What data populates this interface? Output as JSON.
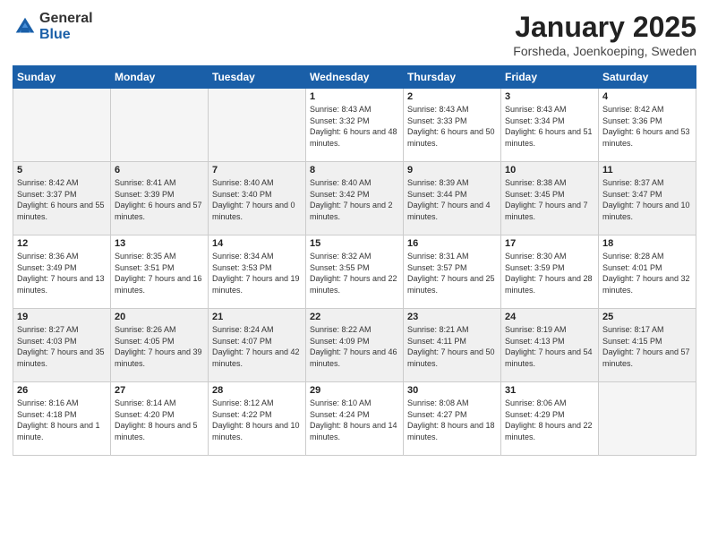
{
  "header": {
    "logo_general": "General",
    "logo_blue": "Blue",
    "month_title": "January 2025",
    "location": "Forsheda, Joenkoeping, Sweden"
  },
  "days_of_week": [
    "Sunday",
    "Monday",
    "Tuesday",
    "Wednesday",
    "Thursday",
    "Friday",
    "Saturday"
  ],
  "weeks": [
    [
      {
        "day": "",
        "sunrise": "",
        "sunset": "",
        "daylight": "",
        "empty": true
      },
      {
        "day": "",
        "sunrise": "",
        "sunset": "",
        "daylight": "",
        "empty": true
      },
      {
        "day": "",
        "sunrise": "",
        "sunset": "",
        "daylight": "",
        "empty": true
      },
      {
        "day": "1",
        "sunrise": "Sunrise: 8:43 AM",
        "sunset": "Sunset: 3:32 PM",
        "daylight": "Daylight: 6 hours and 48 minutes.",
        "empty": false
      },
      {
        "day": "2",
        "sunrise": "Sunrise: 8:43 AM",
        "sunset": "Sunset: 3:33 PM",
        "daylight": "Daylight: 6 hours and 50 minutes.",
        "empty": false
      },
      {
        "day": "3",
        "sunrise": "Sunrise: 8:43 AM",
        "sunset": "Sunset: 3:34 PM",
        "daylight": "Daylight: 6 hours and 51 minutes.",
        "empty": false
      },
      {
        "day": "4",
        "sunrise": "Sunrise: 8:42 AM",
        "sunset": "Sunset: 3:36 PM",
        "daylight": "Daylight: 6 hours and 53 minutes.",
        "empty": false
      }
    ],
    [
      {
        "day": "5",
        "sunrise": "Sunrise: 8:42 AM",
        "sunset": "Sunset: 3:37 PM",
        "daylight": "Daylight: 6 hours and 55 minutes.",
        "empty": false
      },
      {
        "day": "6",
        "sunrise": "Sunrise: 8:41 AM",
        "sunset": "Sunset: 3:39 PM",
        "daylight": "Daylight: 6 hours and 57 minutes.",
        "empty": false
      },
      {
        "day": "7",
        "sunrise": "Sunrise: 8:40 AM",
        "sunset": "Sunset: 3:40 PM",
        "daylight": "Daylight: 7 hours and 0 minutes.",
        "empty": false
      },
      {
        "day": "8",
        "sunrise": "Sunrise: 8:40 AM",
        "sunset": "Sunset: 3:42 PM",
        "daylight": "Daylight: 7 hours and 2 minutes.",
        "empty": false
      },
      {
        "day": "9",
        "sunrise": "Sunrise: 8:39 AM",
        "sunset": "Sunset: 3:44 PM",
        "daylight": "Daylight: 7 hours and 4 minutes.",
        "empty": false
      },
      {
        "day": "10",
        "sunrise": "Sunrise: 8:38 AM",
        "sunset": "Sunset: 3:45 PM",
        "daylight": "Daylight: 7 hours and 7 minutes.",
        "empty": false
      },
      {
        "day": "11",
        "sunrise": "Sunrise: 8:37 AM",
        "sunset": "Sunset: 3:47 PM",
        "daylight": "Daylight: 7 hours and 10 minutes.",
        "empty": false
      }
    ],
    [
      {
        "day": "12",
        "sunrise": "Sunrise: 8:36 AM",
        "sunset": "Sunset: 3:49 PM",
        "daylight": "Daylight: 7 hours and 13 minutes.",
        "empty": false
      },
      {
        "day": "13",
        "sunrise": "Sunrise: 8:35 AM",
        "sunset": "Sunset: 3:51 PM",
        "daylight": "Daylight: 7 hours and 16 minutes.",
        "empty": false
      },
      {
        "day": "14",
        "sunrise": "Sunrise: 8:34 AM",
        "sunset": "Sunset: 3:53 PM",
        "daylight": "Daylight: 7 hours and 19 minutes.",
        "empty": false
      },
      {
        "day": "15",
        "sunrise": "Sunrise: 8:32 AM",
        "sunset": "Sunset: 3:55 PM",
        "daylight": "Daylight: 7 hours and 22 minutes.",
        "empty": false
      },
      {
        "day": "16",
        "sunrise": "Sunrise: 8:31 AM",
        "sunset": "Sunset: 3:57 PM",
        "daylight": "Daylight: 7 hours and 25 minutes.",
        "empty": false
      },
      {
        "day": "17",
        "sunrise": "Sunrise: 8:30 AM",
        "sunset": "Sunset: 3:59 PM",
        "daylight": "Daylight: 7 hours and 28 minutes.",
        "empty": false
      },
      {
        "day": "18",
        "sunrise": "Sunrise: 8:28 AM",
        "sunset": "Sunset: 4:01 PM",
        "daylight": "Daylight: 7 hours and 32 minutes.",
        "empty": false
      }
    ],
    [
      {
        "day": "19",
        "sunrise": "Sunrise: 8:27 AM",
        "sunset": "Sunset: 4:03 PM",
        "daylight": "Daylight: 7 hours and 35 minutes.",
        "empty": false
      },
      {
        "day": "20",
        "sunrise": "Sunrise: 8:26 AM",
        "sunset": "Sunset: 4:05 PM",
        "daylight": "Daylight: 7 hours and 39 minutes.",
        "empty": false
      },
      {
        "day": "21",
        "sunrise": "Sunrise: 8:24 AM",
        "sunset": "Sunset: 4:07 PM",
        "daylight": "Daylight: 7 hours and 42 minutes.",
        "empty": false
      },
      {
        "day": "22",
        "sunrise": "Sunrise: 8:22 AM",
        "sunset": "Sunset: 4:09 PM",
        "daylight": "Daylight: 7 hours and 46 minutes.",
        "empty": false
      },
      {
        "day": "23",
        "sunrise": "Sunrise: 8:21 AM",
        "sunset": "Sunset: 4:11 PM",
        "daylight": "Daylight: 7 hours and 50 minutes.",
        "empty": false
      },
      {
        "day": "24",
        "sunrise": "Sunrise: 8:19 AM",
        "sunset": "Sunset: 4:13 PM",
        "daylight": "Daylight: 7 hours and 54 minutes.",
        "empty": false
      },
      {
        "day": "25",
        "sunrise": "Sunrise: 8:17 AM",
        "sunset": "Sunset: 4:15 PM",
        "daylight": "Daylight: 7 hours and 57 minutes.",
        "empty": false
      }
    ],
    [
      {
        "day": "26",
        "sunrise": "Sunrise: 8:16 AM",
        "sunset": "Sunset: 4:18 PM",
        "daylight": "Daylight: 8 hours and 1 minute.",
        "empty": false
      },
      {
        "day": "27",
        "sunrise": "Sunrise: 8:14 AM",
        "sunset": "Sunset: 4:20 PM",
        "daylight": "Daylight: 8 hours and 5 minutes.",
        "empty": false
      },
      {
        "day": "28",
        "sunrise": "Sunrise: 8:12 AM",
        "sunset": "Sunset: 4:22 PM",
        "daylight": "Daylight: 8 hours and 10 minutes.",
        "empty": false
      },
      {
        "day": "29",
        "sunrise": "Sunrise: 8:10 AM",
        "sunset": "Sunset: 4:24 PM",
        "daylight": "Daylight: 8 hours and 14 minutes.",
        "empty": false
      },
      {
        "day": "30",
        "sunrise": "Sunrise: 8:08 AM",
        "sunset": "Sunset: 4:27 PM",
        "daylight": "Daylight: 8 hours and 18 minutes.",
        "empty": false
      },
      {
        "day": "31",
        "sunrise": "Sunrise: 8:06 AM",
        "sunset": "Sunset: 4:29 PM",
        "daylight": "Daylight: 8 hours and 22 minutes.",
        "empty": false
      },
      {
        "day": "",
        "sunrise": "",
        "sunset": "",
        "daylight": "",
        "empty": true
      }
    ]
  ]
}
